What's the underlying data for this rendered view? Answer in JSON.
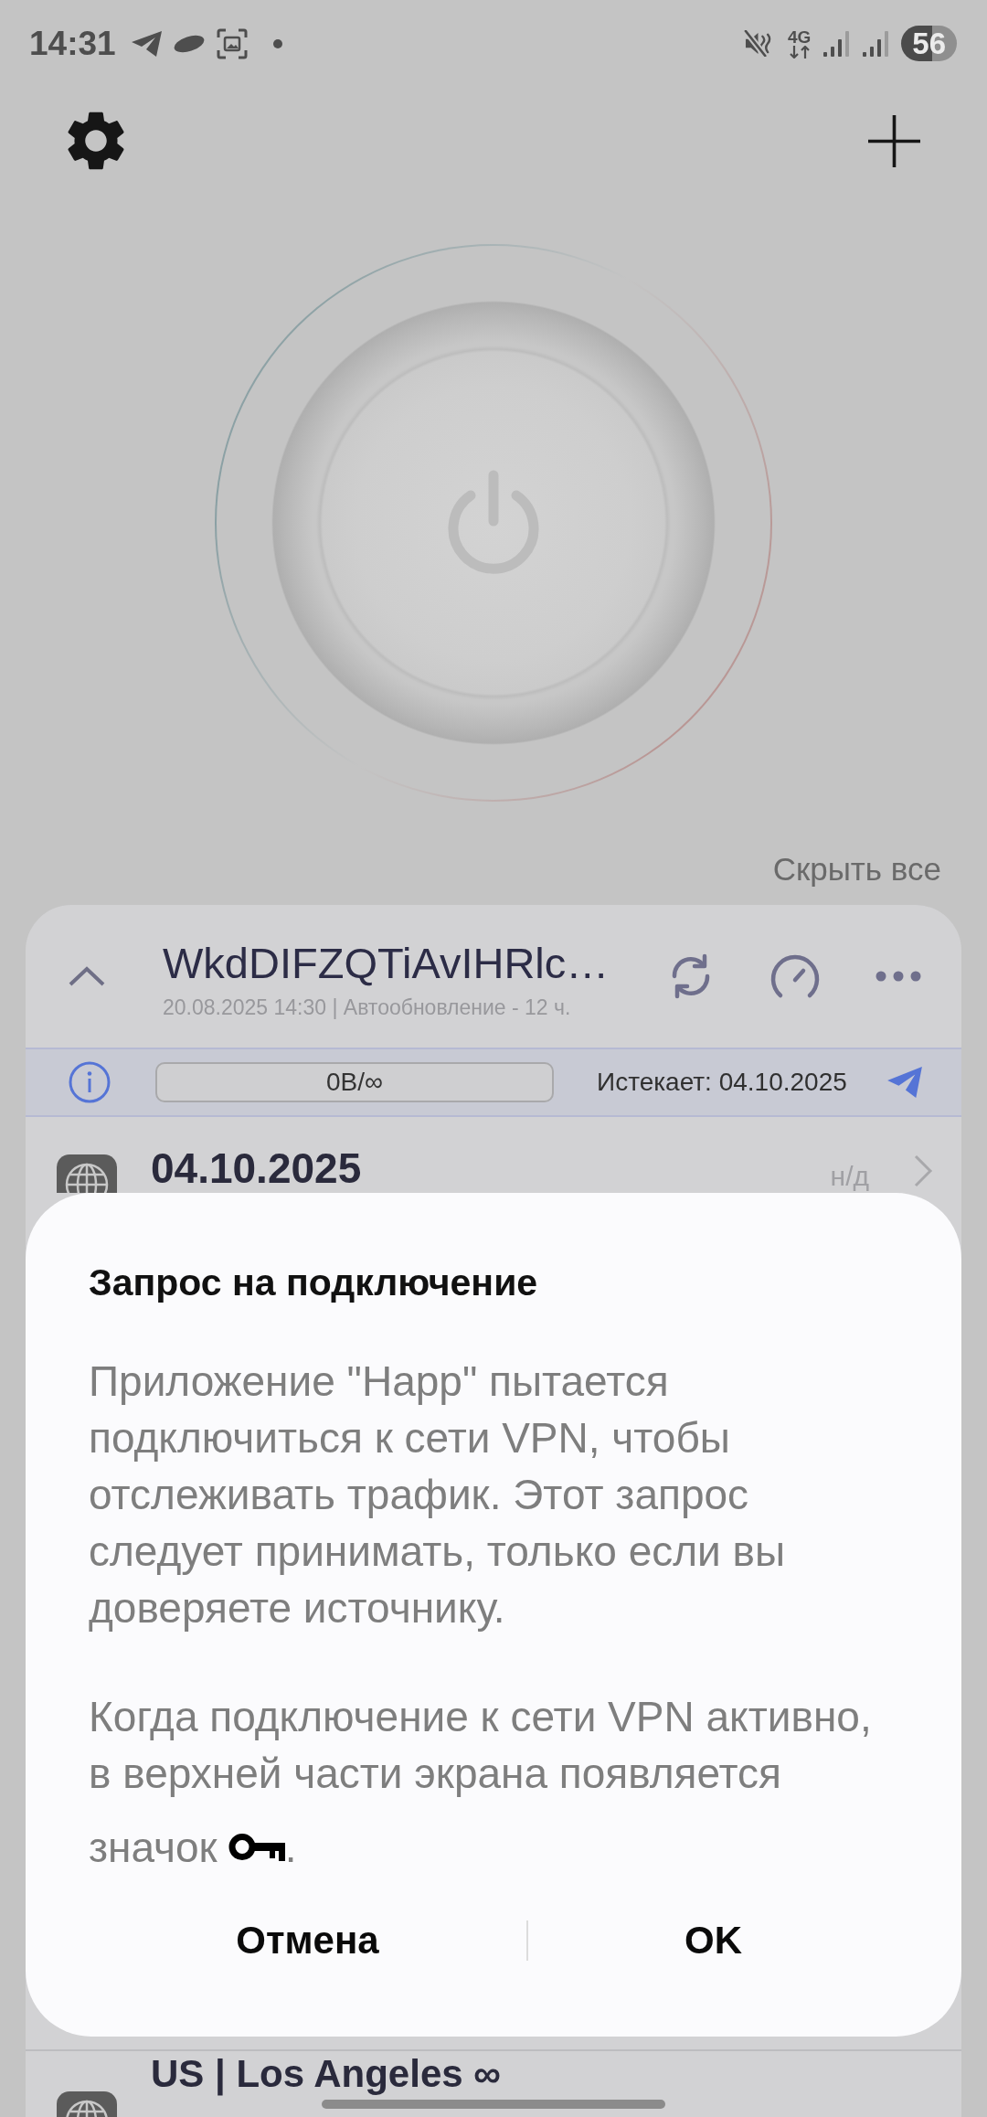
{
  "status_bar": {
    "time": "14:31",
    "network": "4G",
    "battery": "56"
  },
  "power_button": {
    "connected": false
  },
  "hide_all": "Скрыть все",
  "subscription": {
    "expanded": true,
    "name": "WkdDIFZQTiAvIHRlc…",
    "updated": "20.08.2025 14:30 | Автообновление - 12 ч.",
    "traffic": "0B/∞",
    "expires": "Истекает: 04.10.2025",
    "servers": [
      {
        "name": "04.10.2025",
        "ping": "н/д"
      },
      {
        "name": "US | Los Angeles ∞"
      }
    ]
  },
  "dialog": {
    "title": "Запрос на подключение",
    "paragraphs": [
      {
        "text": "Приложение \"Happ\" пытается подключиться к сети VPN, чтобы отслеживать трафик. Этот запрос следует принимать, только если вы доверяете источнику.",
        "inline_icon": false
      },
      {
        "text": "Когда подключение к сети VPN активно, в верхней части экрана появляется значок",
        "inline_icon": true,
        "tail": "."
      }
    ],
    "buttons": [
      {
        "label": "Отмена"
      },
      {
        "label": "OK"
      }
    ]
  }
}
